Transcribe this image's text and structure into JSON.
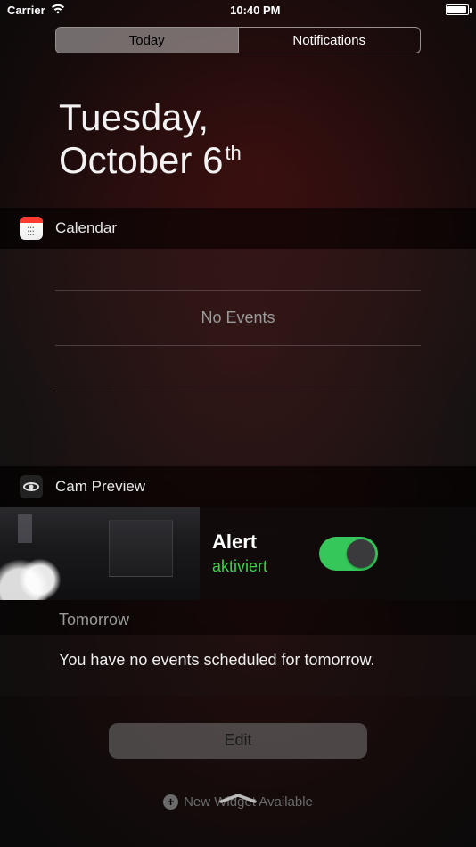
{
  "statusBar": {
    "carrier": "Carrier",
    "time": "10:40 PM"
  },
  "tabs": {
    "today": "Today",
    "notifications": "Notifications"
  },
  "date": {
    "weekday": "Tuesday,",
    "month": "October",
    "day": "6",
    "ordinal": "th"
  },
  "calendar": {
    "title": "Calendar",
    "empty": "No Events"
  },
  "cam": {
    "title": "Cam Preview",
    "alert": "Alert",
    "status": "aktiviert"
  },
  "tomorrow": {
    "heading": "Tomorrow",
    "body": "You have no events scheduled for tomorrow."
  },
  "edit": {
    "label": "Edit"
  },
  "newWidget": {
    "label": "New Widget Available"
  }
}
